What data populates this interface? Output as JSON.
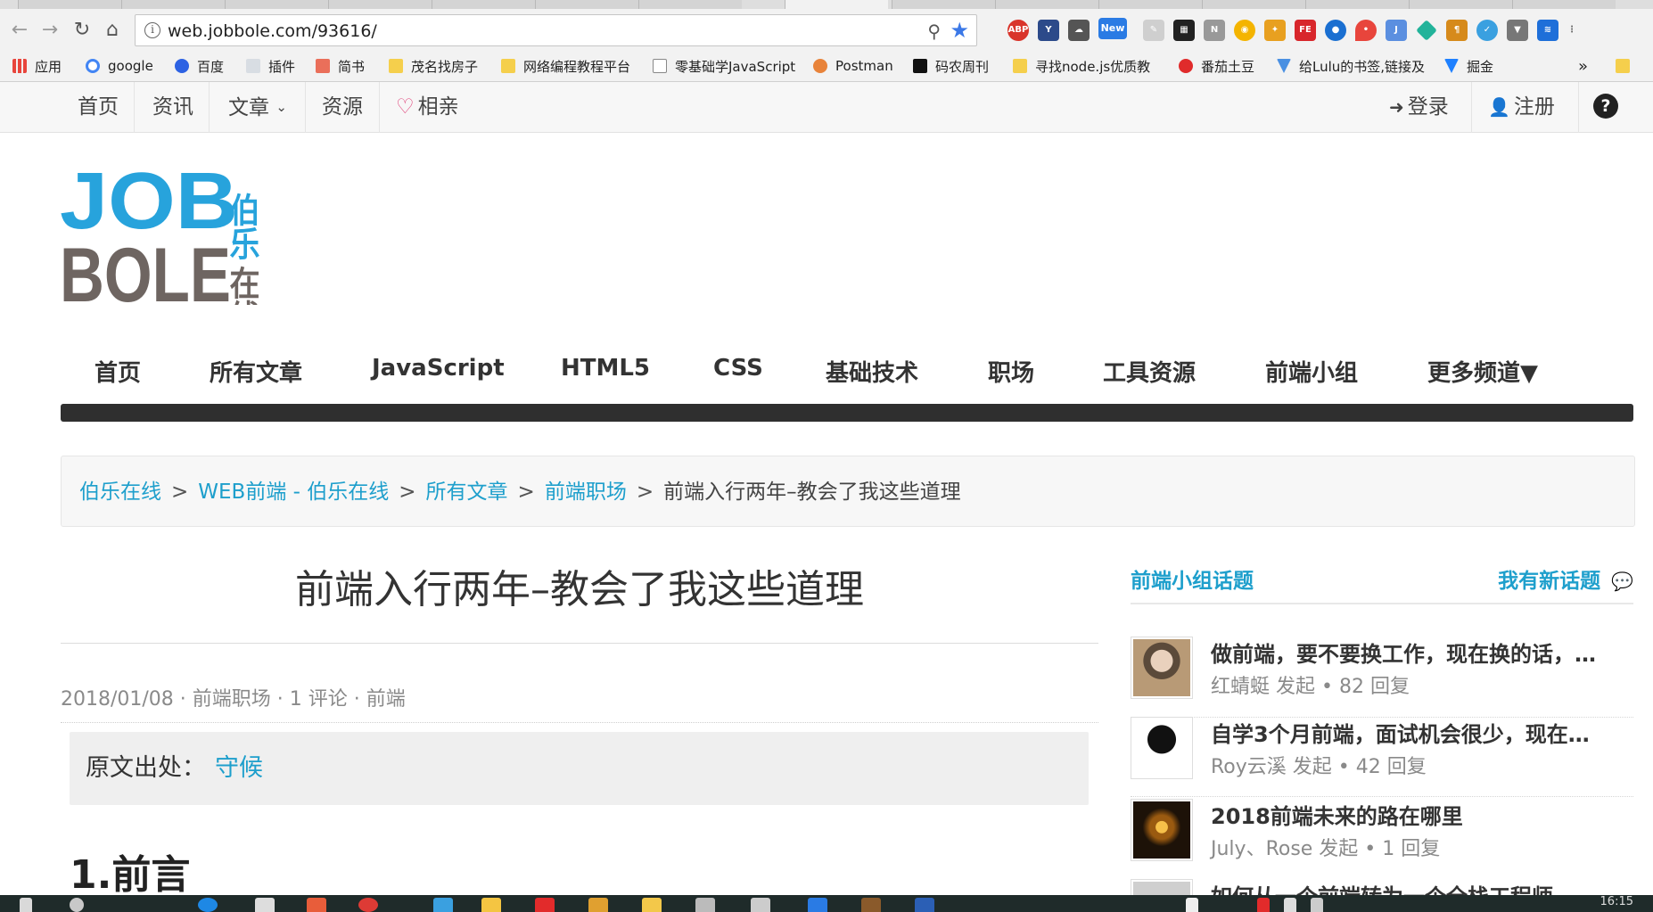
{
  "browser": {
    "url": "web.jobbole.com/93616/",
    "bookmarks": [
      {
        "label": "应用",
        "color": "#e8453c"
      },
      {
        "label": "google",
        "color": "#4285f4"
      },
      {
        "label": "百度",
        "color": "#2d62e3"
      },
      {
        "label": "插件",
        "color": "#9aa5b1"
      },
      {
        "label": "简书",
        "color": "#ea6f5a"
      },
      {
        "label": "茂名找房子",
        "color": "#f5cf4c"
      },
      {
        "label": "网络编程教程平台",
        "color": "#f5cf4c"
      },
      {
        "label": "零基础学JavaScript",
        "color": "#8a8a8a"
      },
      {
        "label": "Postman",
        "color": "#e8833a"
      },
      {
        "label": "码农周刊",
        "color": "#111111"
      },
      {
        "label": "寻找node.js优质教",
        "color": "#f5cf4c"
      },
      {
        "label": "番茄土豆",
        "color": "#e02b2b"
      },
      {
        "label": "给Lulu的书签,链接及",
        "color": "#4a90e2"
      },
      {
        "label": "掘金",
        "color": "#1e80ff"
      }
    ],
    "bookmarks_more": "»",
    "extension_labels": [
      "ABP",
      "N",
      "New"
    ],
    "taskbar_time": "16:15"
  },
  "sitebar": {
    "left": [
      "首页",
      "资讯",
      "文章",
      "资源",
      "相亲"
    ],
    "right": [
      "登录",
      "注册"
    ],
    "help": "?"
  },
  "logo": {
    "line1": "JOB",
    "line2": "BOLE",
    "cn1": "伯乐",
    "cn2": "在线"
  },
  "mainnav": [
    "首页",
    "所有文章",
    "JavaScript",
    "HTML5",
    "CSS",
    "基础技术",
    "职场",
    "工具资源",
    "前端小组",
    "更多频道▼"
  ],
  "breadcrumb": {
    "links": [
      "伯乐在线",
      "WEB前端 - 伯乐在线",
      "所有文章",
      "前端职场"
    ],
    "current": "前端入行两年–教会了我这些道理",
    "separator": ">"
  },
  "article": {
    "title": "前端入行两年–教会了我这些道理",
    "meta": "2018/01/08 · 前端职场 · 1 评论 · 前端",
    "source_label": "原文出处：",
    "source_link": "守候",
    "section_heading": "1.前言"
  },
  "sidebar": {
    "title": "前端小组话题",
    "new_topic": "我有新话题",
    "topics": [
      {
        "title": "做前端，要不要换工作，现在换的话，…",
        "sub": "红蜻蜓 发起 • 82 回复"
      },
      {
        "title": "自学3个月前端，面试机会很少，现在…",
        "sub": "Roy云溪 发起 • 42 回复"
      },
      {
        "title": "2018前端未来的路在哪里",
        "sub": "July、Rose 发起 • 1 回复"
      },
      {
        "title": "如何从一个前端转为一个全栈工程师",
        "sub": ""
      }
    ]
  }
}
